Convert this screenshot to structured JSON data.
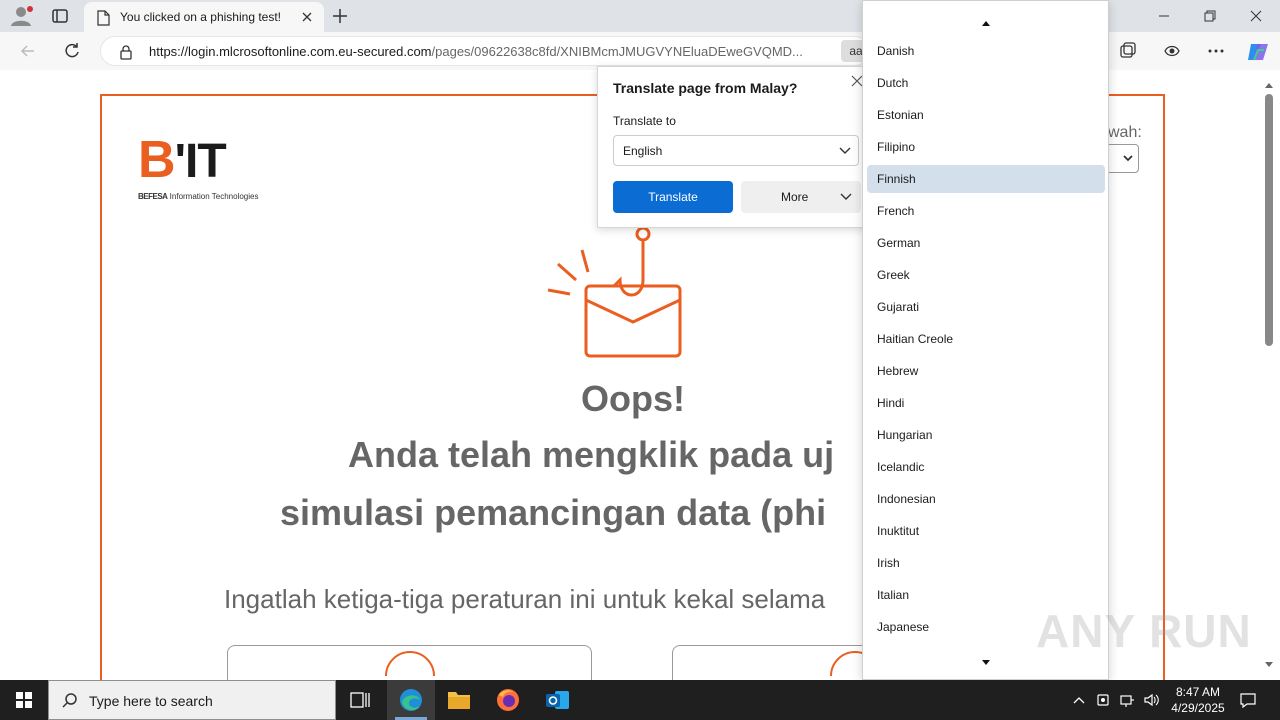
{
  "browser": {
    "tab_title": "You clicked on a phishing test!",
    "url_host": "https://login.mlcrosoftonline.com.eu-secured.com",
    "url_path": "/pages/09622638c8fd/XNIBMcmJMUGVYNEluaDEweGVQMD...",
    "reader_label": "aa"
  },
  "page": {
    "logo_big_b": "B",
    "logo_big_it": "'IT",
    "logo_sub_bold": "BEFESA",
    "logo_sub_rest": " Information Technologies",
    "dropdown_hint": "wah:",
    "oops": "Oops!",
    "line1": "Anda telah mengklik pada uj",
    "line2": "simulasi pemancingan data (phi",
    "remember": "Ingatlah ketiga-tiga peraturan ini untuk kekal selama"
  },
  "translate": {
    "title": "Translate page from Malay?",
    "to_label": "Translate to",
    "selected": "English",
    "translate_button": "Translate",
    "more_button": "More"
  },
  "languages": {
    "items": [
      "Danish",
      "Dutch",
      "Estonian",
      "Filipino",
      "Finnish",
      "French",
      "German",
      "Greek",
      "Gujarati",
      "Haitian Creole",
      "Hebrew",
      "Hindi",
      "Hungarian",
      "Icelandic",
      "Indonesian",
      "Inuktitut",
      "Irish",
      "Italian",
      "Japanese"
    ],
    "selected": "Finnish"
  },
  "watermark": "ANY RUN",
  "taskbar": {
    "search_placeholder": "Type here to search",
    "time": "8:47 AM",
    "date": "4/29/2025"
  },
  "colors": {
    "brand_orange": "#ea5e1f",
    "translate_blue": "#0b6cd4",
    "selected_row": "#d3dfeb"
  }
}
